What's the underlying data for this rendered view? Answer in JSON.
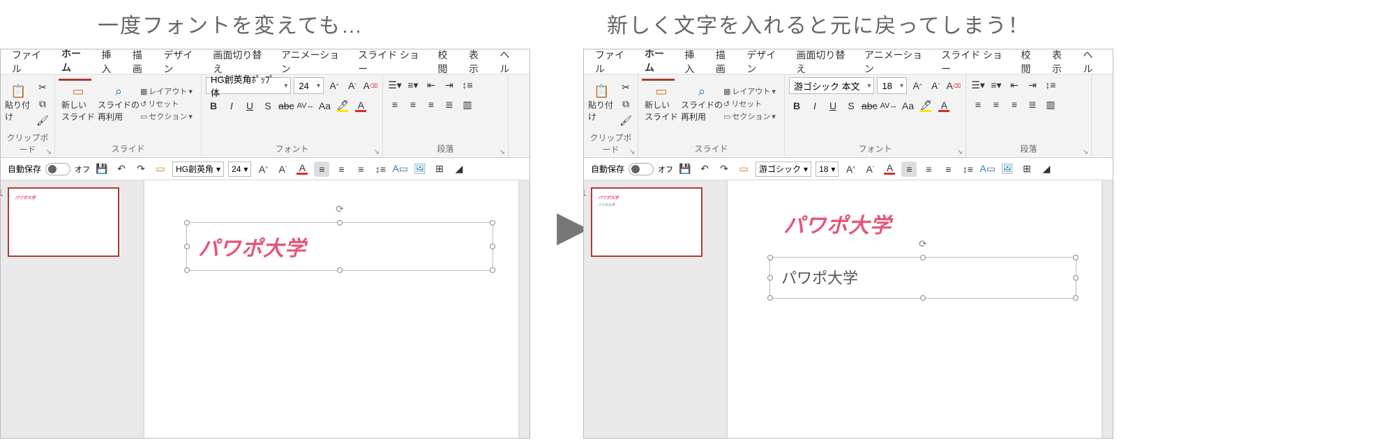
{
  "captions": {
    "left": "一度フォントを変えても…",
    "right": "新しく文字を入れると元に戻ってしまう！"
  },
  "tabs": {
    "file": "ファイル",
    "home": "ホーム",
    "insert": "挿入",
    "draw": "描画",
    "design": "デザイン",
    "transitions": "画面切り替え",
    "animations": "アニメーション",
    "slideshow": "スライド ショー",
    "review": "校閲",
    "view": "表示",
    "help": "ヘル"
  },
  "ribbon": {
    "clipboard_label": "クリップボード",
    "paste": "貼り付け",
    "slides_label": "スライド",
    "new_slide": "新しい\nスライド",
    "reuse_slides": "スライドの\n再利用",
    "layout": "レイアウト",
    "reset": "リセット",
    "section": "セクション",
    "font_label": "フォント",
    "paragraph_label": "段落",
    "bold": "B",
    "italic": "I",
    "underline": "U",
    "strike": "S",
    "abc": "abc",
    "av": "AV",
    "aa": "Aa",
    "increase_font": "A^",
    "decrease_font": "Aˇ",
    "clear_format": "Aᵩ"
  },
  "qat": {
    "autosave": "自動保存",
    "off": "オフ"
  },
  "slide": {
    "number": "1",
    "text_pink": "パワポ大学",
    "text_plain": "パワポ大学"
  },
  "left_window": {
    "font_name": "HG創英角ﾎﾟｯﾌﾟ体",
    "font_size": "24",
    "qat_font": "HG創英角",
    "qat_size": "24"
  },
  "right_window": {
    "font_name": "游ゴシック 本文",
    "font_size": "18",
    "qat_font": "游ゴシック",
    "qat_size": "18"
  }
}
